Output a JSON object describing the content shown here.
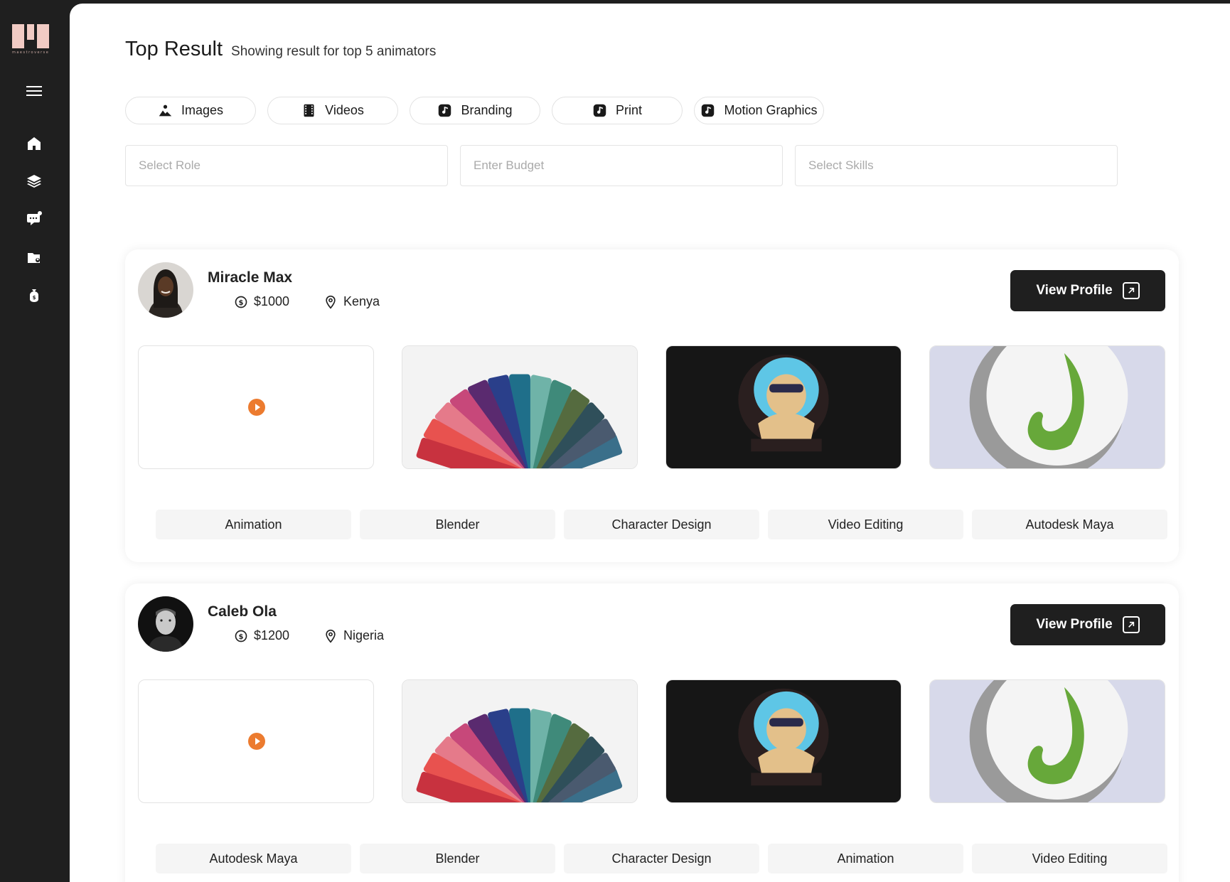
{
  "brand": {
    "wordmark": "maestroverse",
    "colors": {
      "logo": "#f1cbc4",
      "sidebar": "#1f1f1f"
    }
  },
  "sidebar": {
    "items": [
      {
        "icon": "menu-icon"
      },
      {
        "icon": "home-icon"
      },
      {
        "icon": "layers-icon"
      },
      {
        "icon": "chat-icon"
      },
      {
        "icon": "folder-user-icon"
      },
      {
        "icon": "money-bag-icon"
      }
    ]
  },
  "header": {
    "title": "Top Result",
    "subtitle": "Showing result for top 5 animators"
  },
  "categories": [
    {
      "label": "Images",
      "icon": "image-icon"
    },
    {
      "label": "Videos",
      "icon": "film-icon"
    },
    {
      "label": "Branding",
      "icon": "music-note-icon"
    },
    {
      "label": "Print",
      "icon": "music-note-icon"
    },
    {
      "label": "Motion Graphics",
      "icon": "music-note-icon"
    }
  ],
  "filters": {
    "role_placeholder": "Select Role",
    "budget_placeholder": "Enter Budget",
    "skills_placeholder": "Select Skills"
  },
  "results": [
    {
      "name": "Miracle Max",
      "price": "$1000",
      "location": "Kenya",
      "view_label": "View Profile",
      "skills": [
        "Animation",
        "Blender",
        "Character Design",
        "Video Editing",
        "Autodesk Maya"
      ]
    },
    {
      "name": "Caleb Ola",
      "price": "$1200",
      "location": "Nigeria",
      "view_label": "View Profile",
      "skills": [
        "Autodesk Maya",
        "Blender",
        "Character Design",
        "Animation",
        "Video Editing"
      ]
    }
  ],
  "colors": {
    "accent_play": "#ec7b2f",
    "button_dark": "#1f1f1f"
  }
}
